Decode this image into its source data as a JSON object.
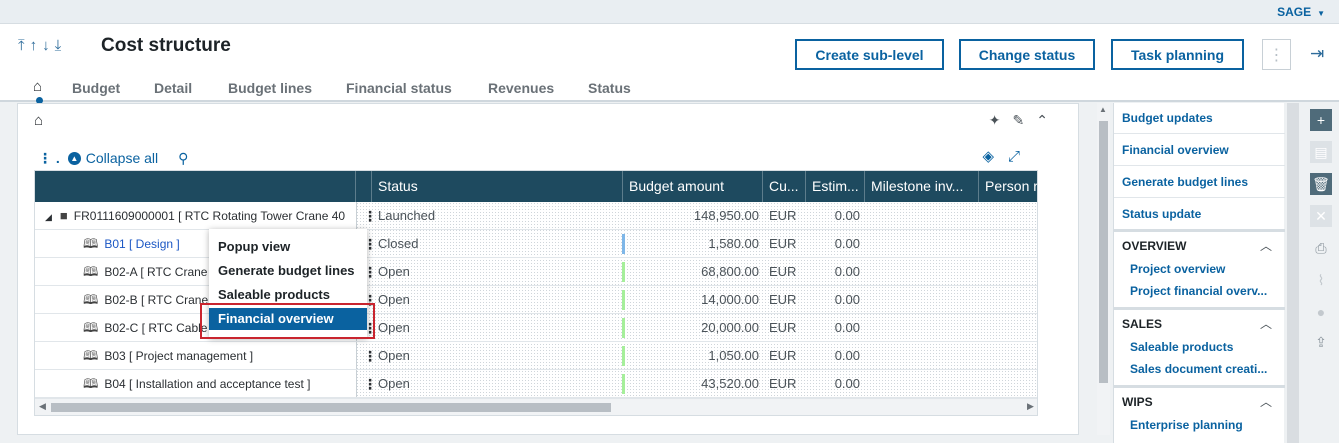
{
  "user": {
    "name": "SAGE"
  },
  "header": {
    "title": "Cost structure",
    "buttons": {
      "create_sub_level": "Create sub-level",
      "change_status": "Change status",
      "task_planning": "Task planning"
    }
  },
  "tabs": [
    "Budget",
    "Detail",
    "Budget lines",
    "Financial status",
    "Revenues",
    "Status"
  ],
  "toolbar": {
    "collapse_all": "Collapse all"
  },
  "grid": {
    "columns": [
      "Status",
      "Budget amount",
      "Cu...",
      "Estim...",
      "Milestone inv...",
      "Person r"
    ],
    "rows": [
      {
        "name": "FR0111609000001 [ RTC Rotating Tower Crane 40",
        "status": "Launched",
        "amount": "148,950.00",
        "currency": "EUR",
        "estimate": "0.00",
        "bar": ""
      },
      {
        "name": "B01 [ Design ]",
        "status": "Closed",
        "amount": "1,580.00",
        "currency": "EUR",
        "estimate": "0.00",
        "bar": "#7fb7e8"
      },
      {
        "name": "B02-A [ RTC Crane T",
        "status": "Open",
        "amount": "68,800.00",
        "currency": "EUR",
        "estimate": "0.00",
        "bar": "#a6ef9b"
      },
      {
        "name": "B02-B [ RTC Crane ",
        "status": "Open",
        "amount": "14,000.00",
        "currency": "EUR",
        "estimate": "0.00",
        "bar": "#a6ef9b"
      },
      {
        "name": "B02-C [ RTC Cable F",
        "status": "Open",
        "amount": "20,000.00",
        "currency": "EUR",
        "estimate": "0.00",
        "bar": "#a6ef9b"
      },
      {
        "name": "B03 [ Project management ]",
        "status": "Open",
        "amount": "1,050.00",
        "currency": "EUR",
        "estimate": "0.00",
        "bar": "#a6ef9b"
      },
      {
        "name": "B04 [ Installation and acceptance test ]",
        "status": "Open",
        "amount": "43,520.00",
        "currency": "EUR",
        "estimate": "0.00",
        "bar": "#a6ef9b"
      }
    ]
  },
  "context_menu": {
    "items": [
      "Popup view",
      "Generate budget lines",
      "Saleable products",
      "Financial overview"
    ],
    "selected": "Financial overview"
  },
  "sidebar": {
    "links": [
      "Budget updates",
      "Financial overview",
      "Generate budget lines",
      "Status update"
    ],
    "sections": [
      {
        "title": "OVERVIEW",
        "items": [
          "Project overview",
          "Project financial overv..."
        ]
      },
      {
        "title": "SALES",
        "items": [
          "Saleable products",
          "Sales document creati..."
        ]
      },
      {
        "title": "WIPS",
        "items": [
          "Enterprise planning"
        ]
      }
    ]
  },
  "colors": {
    "accent": "#0a62a0",
    "grid_header": "#1e4a5f",
    "menu_highlight": "#0a62a0",
    "outline": "#c9252f"
  }
}
